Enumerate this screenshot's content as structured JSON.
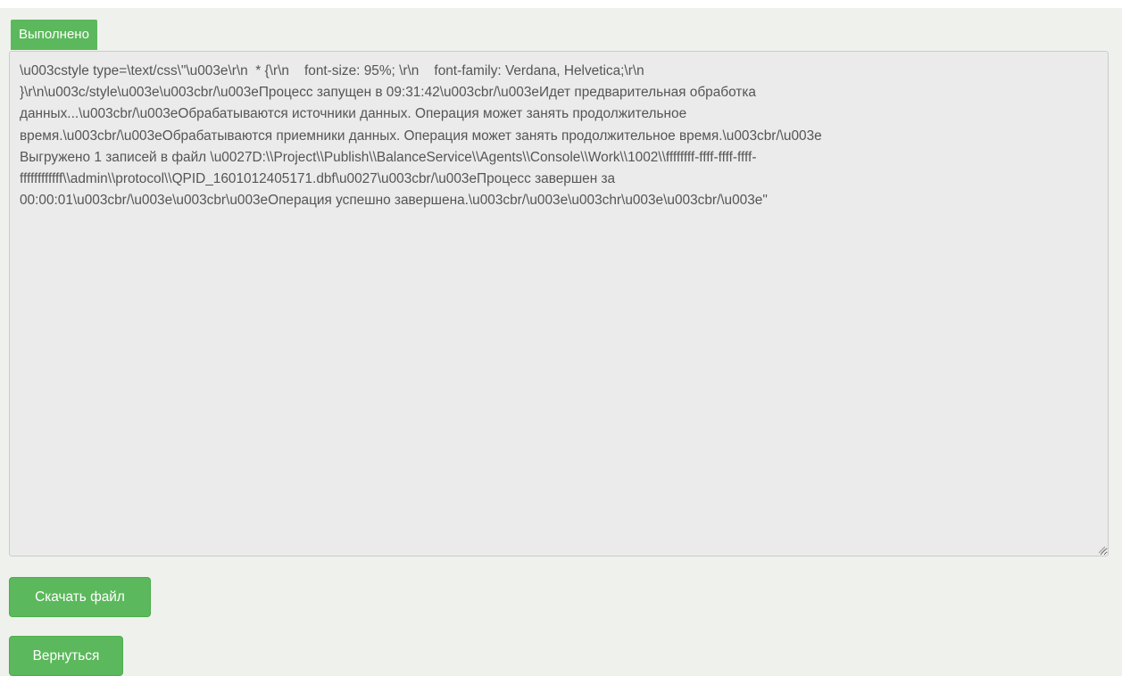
{
  "status": {
    "label": "Выполнено",
    "color": "#5cb85c"
  },
  "log": {
    "text": "\\u003cstyle type=\\text/css\\\"\\u003e\\r\\n  * {\\r\\n    font-size: 95%; \\r\\n    font-family: Verdana, Helvetica;\\r\\n\n}\\r\\n\\u003c/style\\u003e\\u003cbr/\\u003eПроцесс запущен в 09:31:42\\u003cbr/\\u003eИдет предварительная обработка\nданных...\\u003cbr/\\u003eОбрабатываются источники данных. Операция может занять продолжительное\nвремя.\\u003cbr/\\u003eОбрабатываются приемники данных. Операция может занять продолжительное время.\\u003cbr/\\u003e\nВыгружено 1 записей в файл \\u0027D:\\\\Project\\\\Publish\\\\BalanceService\\\\Agents\\\\Console\\\\Work\\\\1002\\\\ffffffff-ffff-ffff-ffff-\nffffffffffff\\\\admin\\\\protocol\\\\QPID_1601012405171.dbf\\u0027\\u003cbr/\\u003eПроцесс завершен за\n00:00:01\\u003cbr/\\u003e\\u003cbr\\u003eОперация успешно завершена.\\u003cbr/\\u003e\\u003chr\\u003e\\u003cbr/\\u003e\""
  },
  "buttons": {
    "download_label": "Скачать файл",
    "back_label": "Вернуться"
  },
  "colors": {
    "accent": "#5cb85c",
    "page_background": "#eef1ec",
    "log_background": "#ebebeb",
    "log_text": "#555555"
  }
}
